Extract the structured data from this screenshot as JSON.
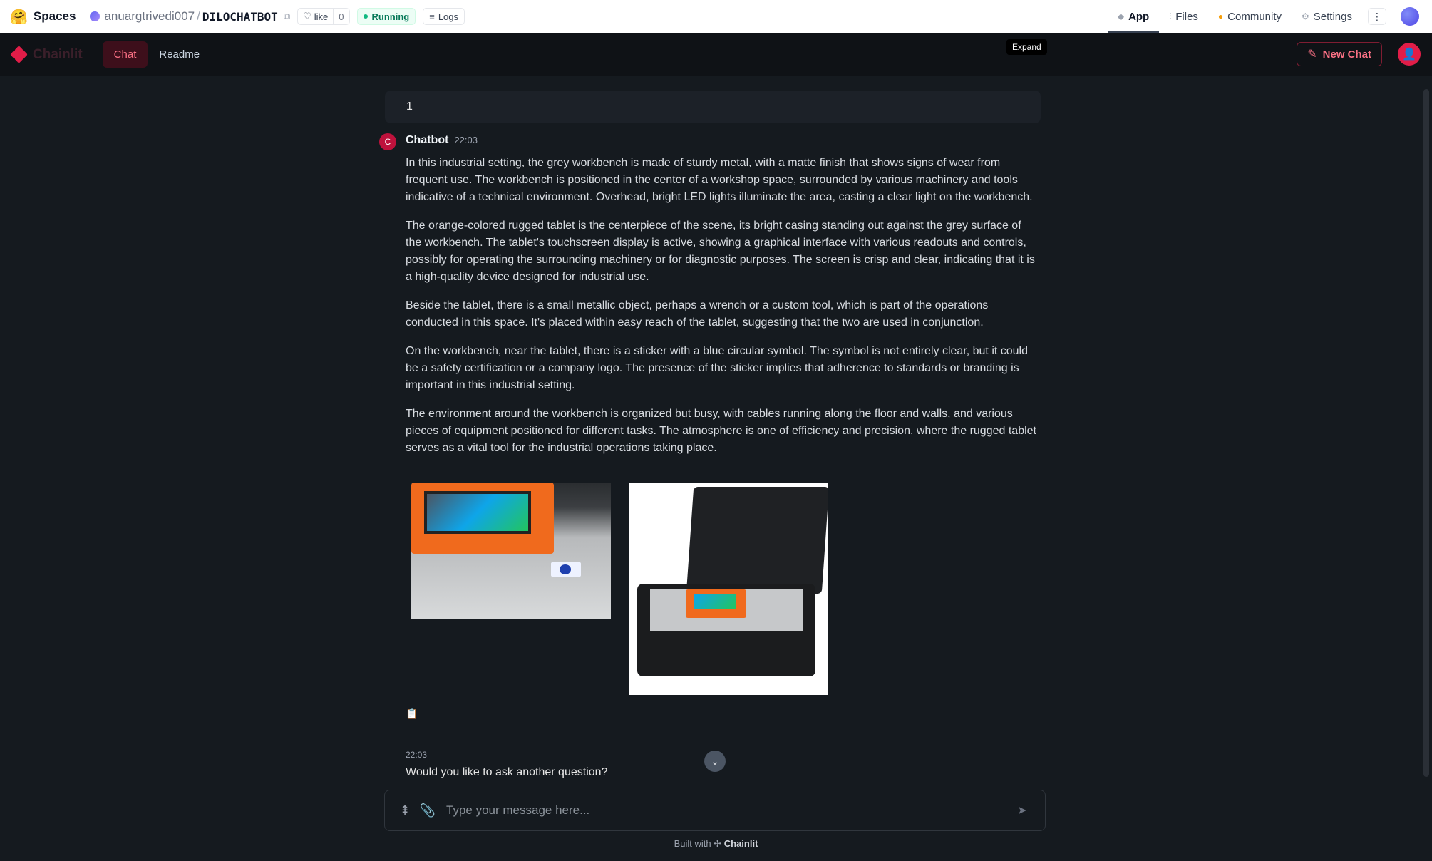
{
  "hf": {
    "spaces_label": "Spaces",
    "user": "anuargtrivedi007",
    "separator": "/",
    "repo": "DILOCHATBOT",
    "like_label": "like",
    "like_count": "0",
    "status": "Running",
    "logs_label": "Logs",
    "tabs": [
      {
        "label": "App",
        "icon": "cube-icon"
      },
      {
        "label": "Files",
        "icon": "files-icon"
      },
      {
        "label": "Community",
        "icon": "community-icon"
      },
      {
        "label": "Settings",
        "icon": "gear-icon"
      }
    ]
  },
  "header": {
    "brand": "Chainlit",
    "nav": [
      "Chat",
      "Readme"
    ],
    "tooltip": "Expand",
    "new_chat": "New Chat"
  },
  "chat": {
    "user_message": "1",
    "bot_avatar_letter": "C",
    "bot_name": "Chatbot",
    "bot_time": "22:03",
    "paragraphs": [
      "In this industrial setting, the grey workbench is made of sturdy metal, with a matte finish that shows signs of wear from frequent use. The workbench is positioned in the center of a workshop space, surrounded by various machinery and tools indicative of a technical environment. Overhead, bright LED lights illuminate the area, casting a clear light on the workbench.",
      "The orange-colored rugged tablet is the centerpiece of the scene, its bright casing standing out against the grey surface of the workbench. The tablet's touchscreen display is active, showing a graphical interface with various readouts and controls, possibly for operating the surrounding machinery or for diagnostic purposes. The screen is crisp and clear, indicating that it is a high-quality device designed for industrial use.",
      "Beside the tablet, there is a small metallic object, perhaps a wrench or a custom tool, which is part of the operations conducted in this space. It's placed within easy reach of the tablet, suggesting that the two are used in conjunction.",
      "On the workbench, near the tablet, there is a sticker with a blue circular symbol. The symbol is not entirely clear, but it could be a safety certification or a company logo. The presence of the sticker implies that adherence to standards or branding is important in this industrial setting.",
      "The environment around the workbench is organized but busy, with cables running along the floor and walls, and various pieces of equipment positioned for different tasks. The atmosphere is one of efficiency and precision, where the rugged tablet serves as a vital tool for the industrial operations taking place."
    ],
    "second_time": "22:03",
    "second_message": "Would you like to ask another question?"
  },
  "composer": {
    "placeholder": "Type your message here..."
  },
  "footer": {
    "prefix": "Built with",
    "brand": "Chainlit"
  }
}
